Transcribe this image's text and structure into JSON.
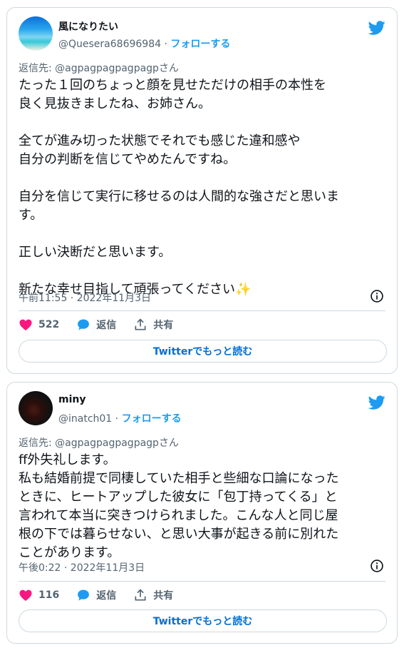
{
  "tweets": [
    {
      "display_name": "風になりたい",
      "handle": "@Quesera68696984",
      "separator": " · ",
      "follow_label": "フォローする",
      "reply_prefix": "返信先: ",
      "reply_handle": "@agpagpagpagpagp",
      "reply_suffix": "さん",
      "text": "たった１回のちょっと顔を見せただけの相手の本性を\n良く見抜きましたね、お姉さん。\n\n全てが進み切った状態でそれでも感じた違和感や\n自分の判断を信じてやめたんですね。\n\n自分を信じて実行に移せるのは人間的な強さだと思いま\nす。\n\n正しい決断だと思います。\n\n新たな幸せ目指して頑張ってください✨",
      "timestamp": "午前11:55 · 2022年11月3日",
      "likes": "522",
      "reply_label": "返信",
      "share_label": "共有",
      "read_more": "Twitterでもっと読む"
    },
    {
      "display_name": "miny",
      "handle": "@inatch01",
      "separator": " · ",
      "follow_label": "フォローする",
      "reply_prefix": "返信先: ",
      "reply_handle": "@agpagpagpagpagp",
      "reply_suffix": "さん",
      "text": "ff外失礼します。\n私も結婚前提で同棲していた相手と些細な口論になった\nときに、ヒートアップした彼女に「包丁持ってくる」と\n言われて本当に突きつけられました。こんな人と同じ屋\n根の下では暮らせない、と思い大事が起きる前に別れた\nことがあります。",
      "timestamp": "午後0:22 · 2022年11月3日",
      "likes": "116",
      "reply_label": "返信",
      "share_label": "共有",
      "read_more": "Twitterでもっと読む"
    }
  ],
  "colors": {
    "twitter_blue": "#1d9bf0",
    "like_red": "#f91880",
    "muted": "#536471",
    "border": "#cfd9de",
    "link": "#006fd6"
  }
}
